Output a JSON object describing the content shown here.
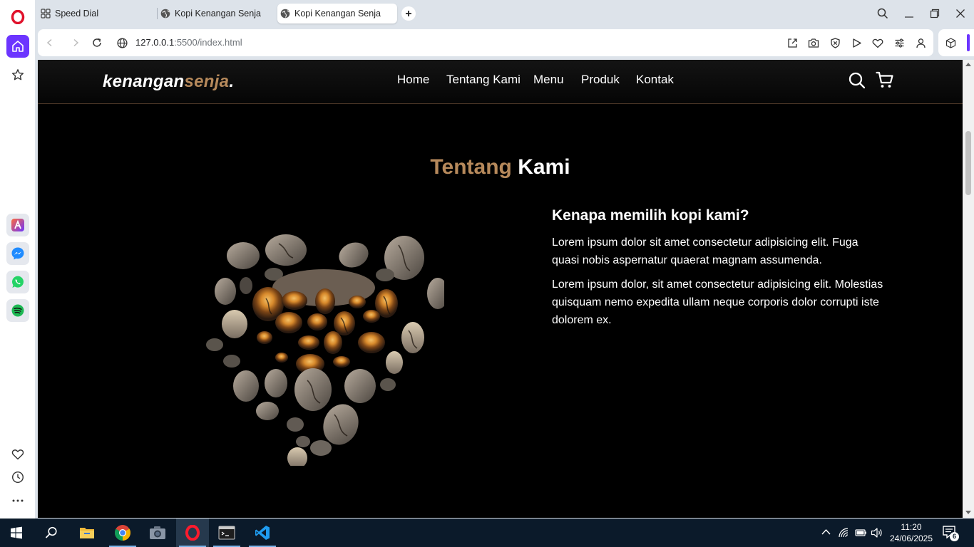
{
  "browser": {
    "tabs": [
      {
        "label": "Speed Dial",
        "icon": "speed-dial-icon",
        "active": false
      },
      {
        "label": "Kopi Kenangan Senja",
        "icon": "globe-icon",
        "active": false
      },
      {
        "label": "Kopi Kenangan Senja",
        "icon": "globe-icon",
        "active": true
      }
    ],
    "url": {
      "host": "127.0.0.1",
      "path": ":5500/index.html"
    }
  },
  "site": {
    "logo": {
      "main": "kenangan",
      "accent": "senja",
      "dot": "."
    },
    "nav": [
      "Home",
      "Tentang Kami",
      "Menu",
      "Produk",
      "Kontak"
    ],
    "about": {
      "title_accent": "Tentang",
      "title_rest": " Kami",
      "heading": "Kenapa memilih kopi kami?",
      "paragraphs": [
        "Lorem ipsum dolor sit amet consectetur adipisicing elit. Fuga quasi nobis aspernatur quaerat magnam assumenda.",
        "Lorem ipsum dolor, sit amet consectetur adipisicing elit. Molestias quisquam nemo expedita ullam neque corporis dolor corrupti iste dolorem ex."
      ]
    }
  },
  "taskbar": {
    "time": "11:20",
    "date": "24/06/2025",
    "notifications": "6"
  },
  "colors": {
    "accent": "#b6895b",
    "page_bg": "#000000"
  }
}
